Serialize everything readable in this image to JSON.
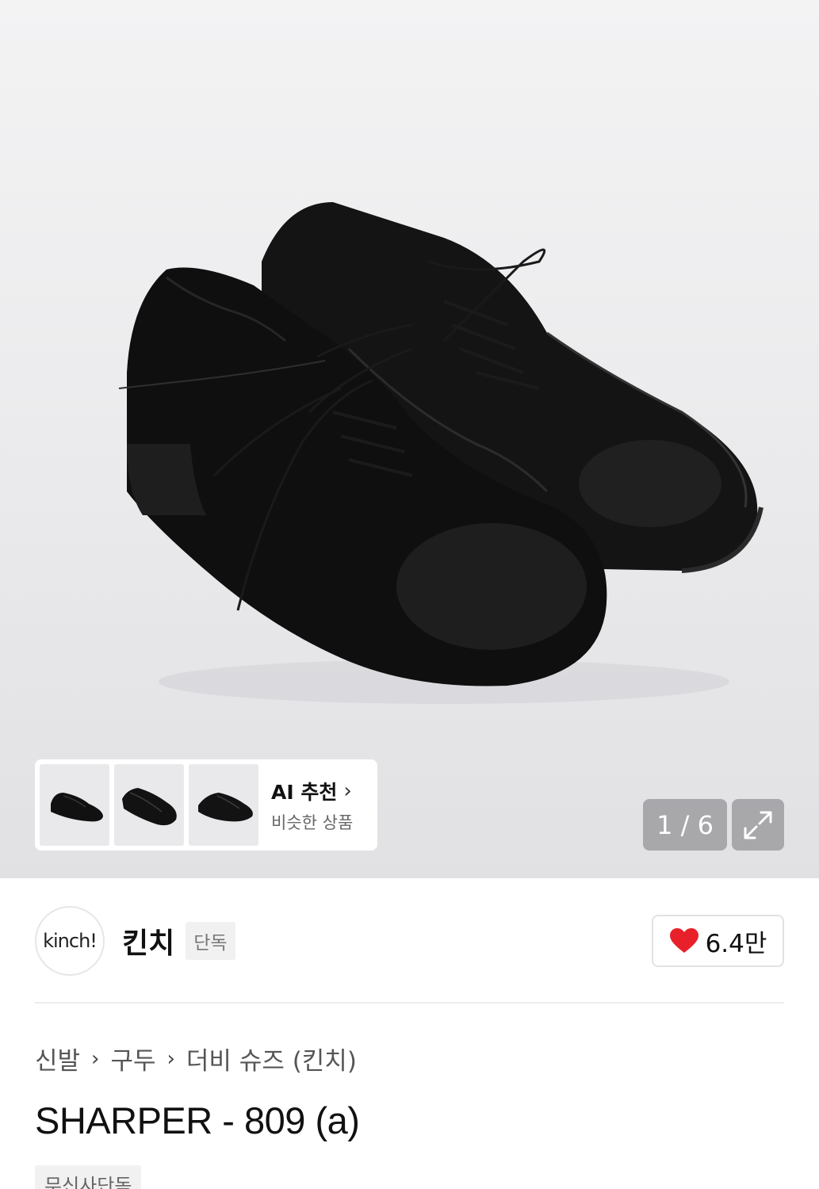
{
  "gallery": {
    "counter": "1 / 6",
    "thumbnails": [
      {
        "icon": "shoe-thumbnail-1"
      },
      {
        "icon": "shoe-thumbnail-2"
      },
      {
        "icon": "shoe-thumbnail-3"
      }
    ],
    "ai_recommend": {
      "title": "AI 추천",
      "subtitle": "비슷한 상품"
    }
  },
  "brand": {
    "logo_text": "kinch!",
    "name": "킨치",
    "badge": "단독",
    "likes": "6.4만",
    "like_color": "#e8202a"
  },
  "breadcrumb": [
    "신발",
    "구두",
    "더비 슈즈 (킨치)"
  ],
  "product": {
    "title": "SHARPER - 809 (a)",
    "tag": "무신사단독"
  }
}
